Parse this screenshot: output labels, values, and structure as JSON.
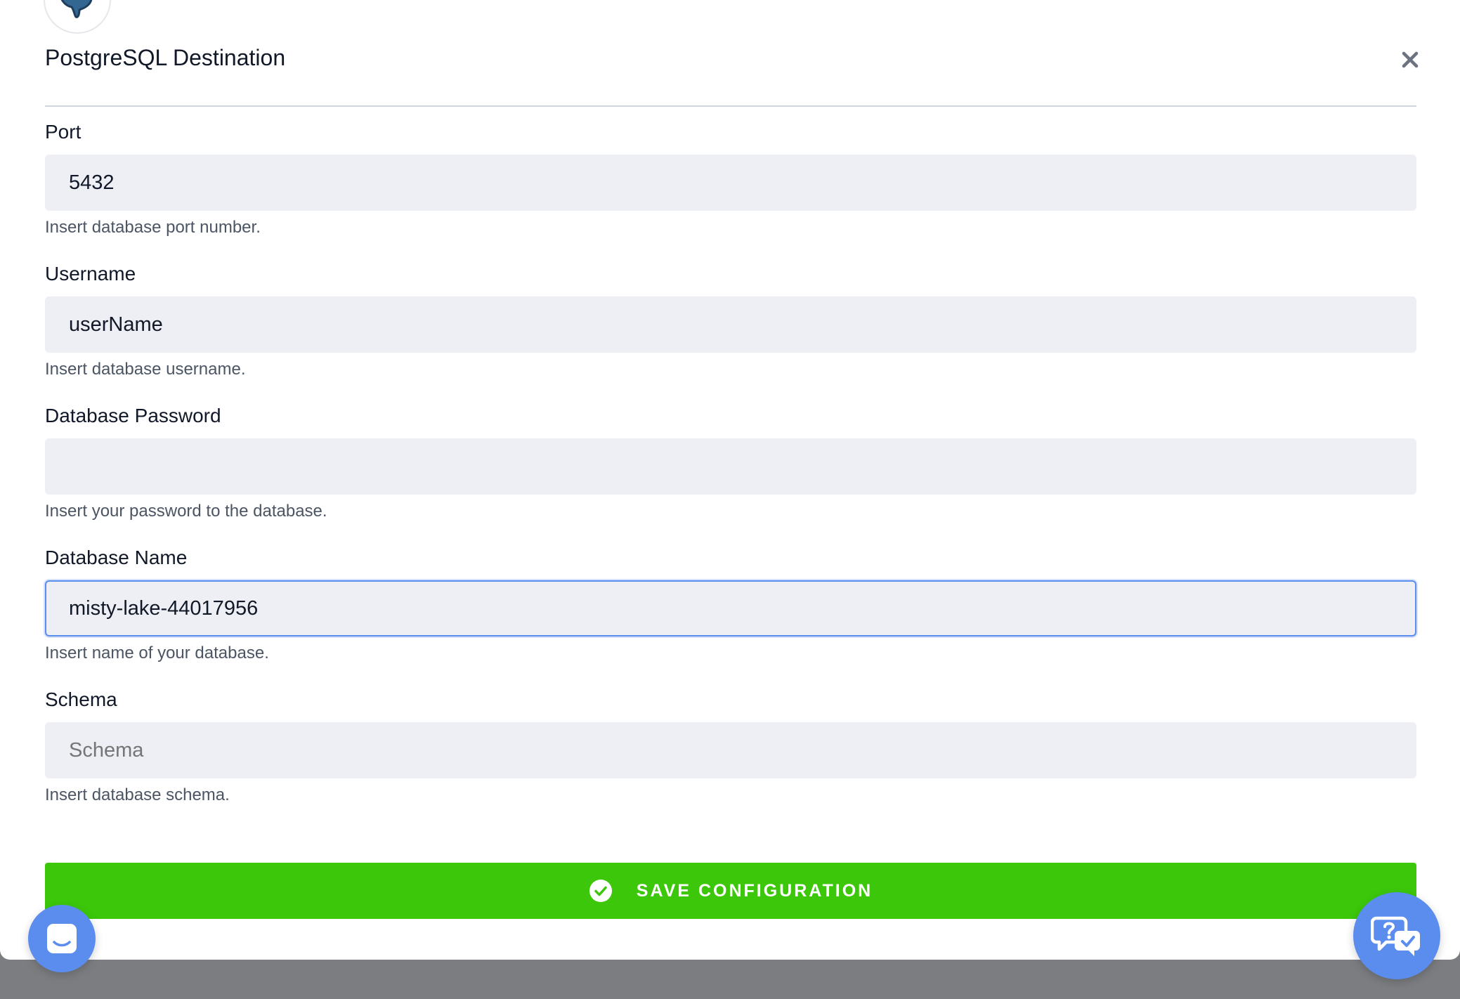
{
  "modal": {
    "title": "PostgreSQL Destination"
  },
  "fields": [
    {
      "label": "Port",
      "value": "5432",
      "placeholder": "",
      "help": "Insert database port number."
    },
    {
      "label": "Username",
      "value": "userName",
      "placeholder": "",
      "help": "Insert database username."
    },
    {
      "label": "Database Password",
      "value": "",
      "placeholder": "",
      "help": "Insert your password to the database."
    },
    {
      "label": "Database Name",
      "value": "misty-lake-44017956",
      "placeholder": "",
      "help": "Insert name of your database."
    },
    {
      "label": "Schema",
      "value": "",
      "placeholder": "Schema",
      "help": "Insert database schema."
    }
  ],
  "save_button": {
    "label": "SAVE CONFIGURATION",
    "icon": "check-circle-icon"
  },
  "icons": {
    "logo": "postgresql-elephant-logo",
    "close": "close-icon",
    "chat": "chat-launcher-icon",
    "help": "help-chat-icon"
  },
  "colors": {
    "accent_green": "#3cc70b",
    "focus_blue": "#5b8def",
    "input_bg": "#eeeff4",
    "overlay_gray": "#7b7d80"
  }
}
